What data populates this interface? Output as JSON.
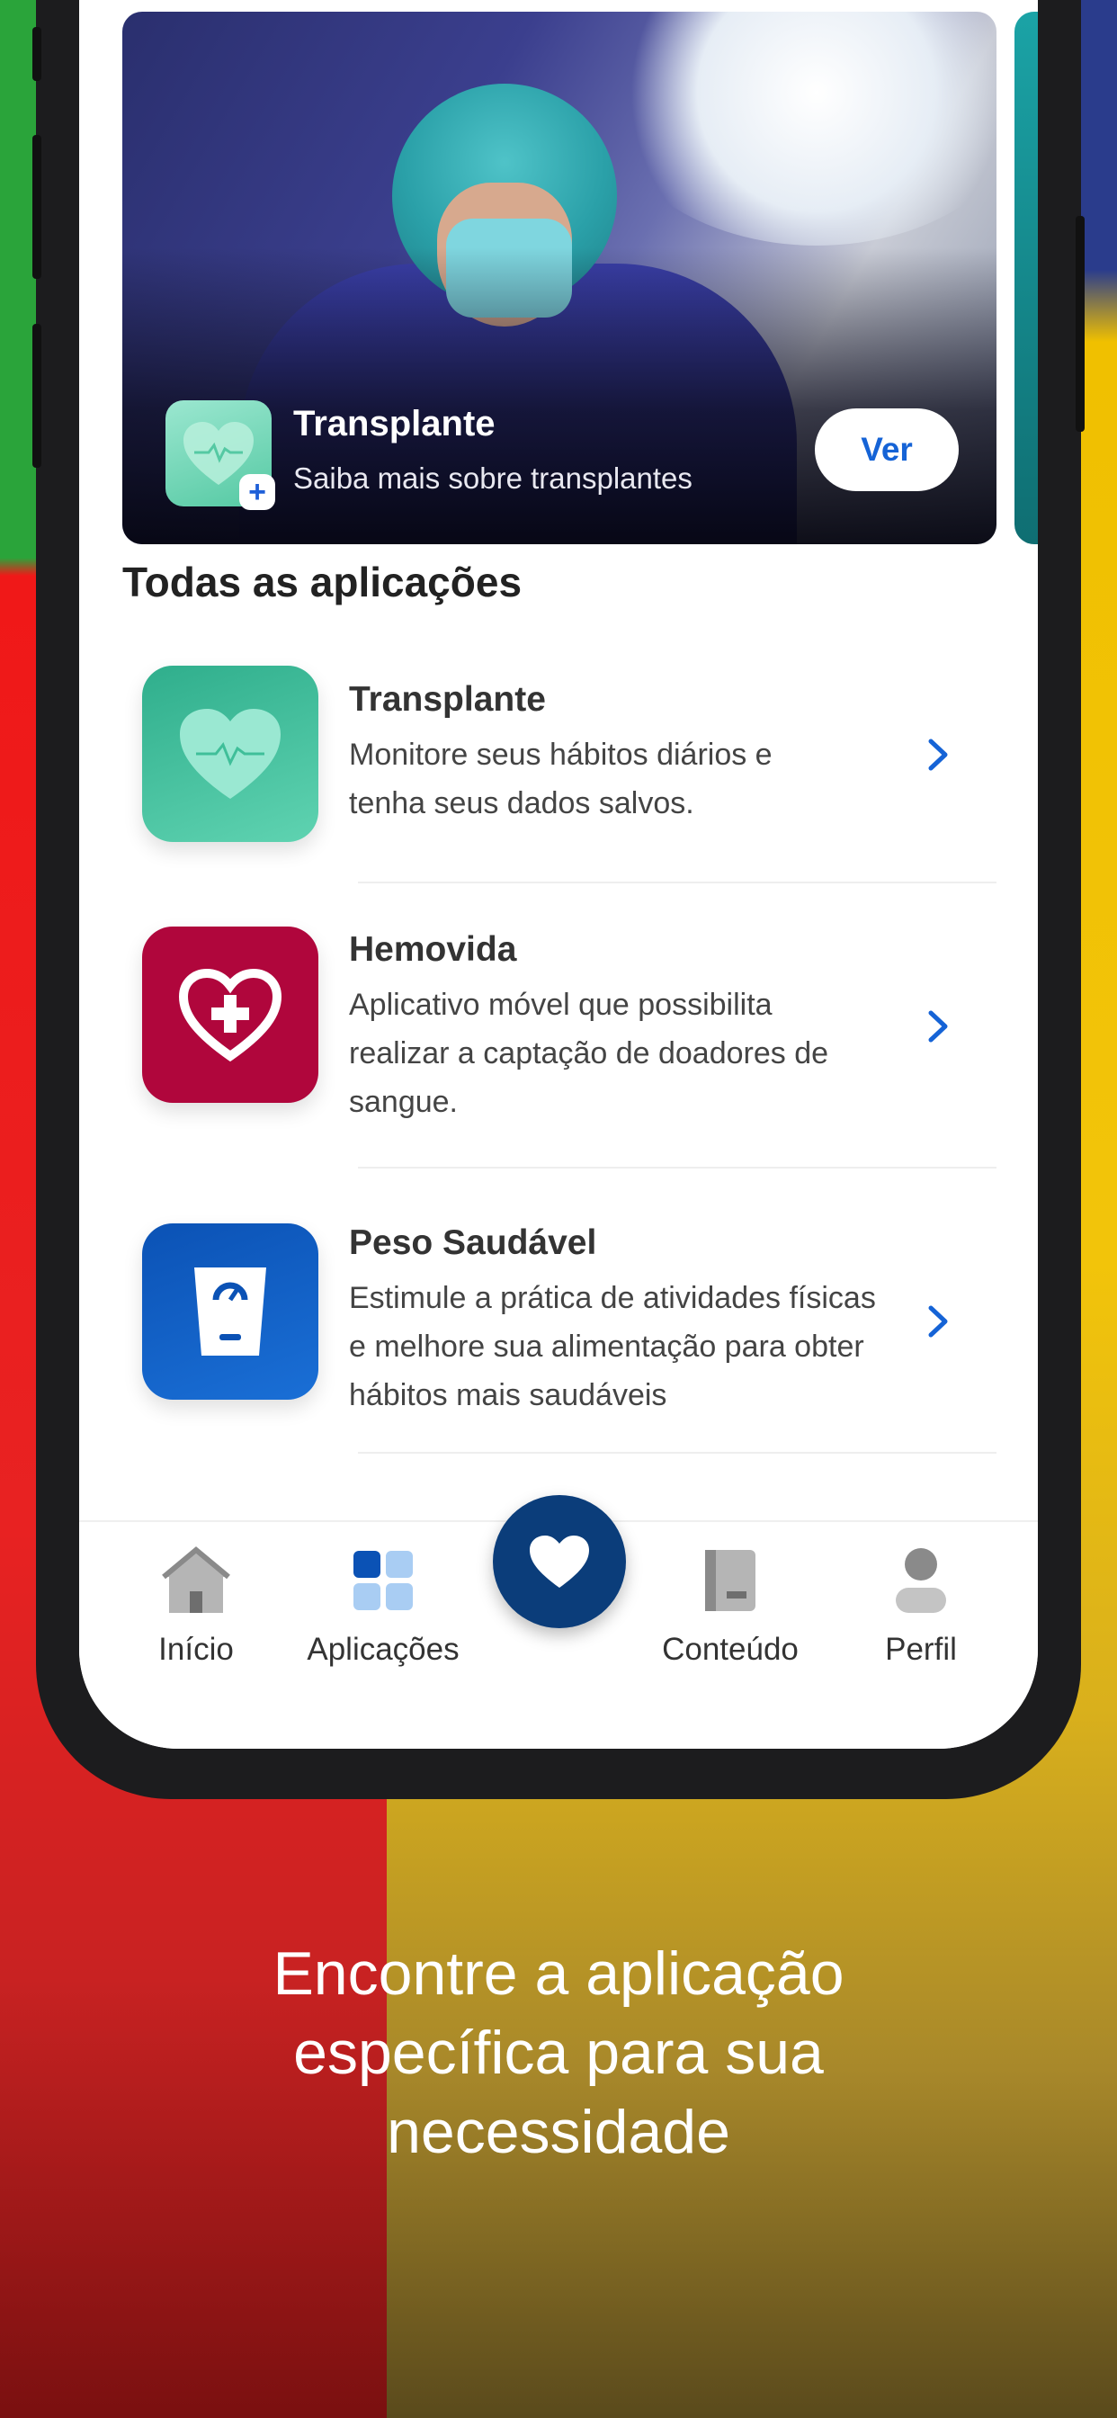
{
  "colors": {
    "accent": "#1563d6",
    "nav_fab": "#0b3d7a",
    "transplante_icon": "#55c9a3",
    "hemovida_icon": "#b0063c",
    "peso_icon": "#0b52b5"
  },
  "banner": {
    "title": "Transplante",
    "subtitle": "Saiba mais sobre transplantes",
    "button_label": "Ver",
    "icon": "heart-plus-icon"
  },
  "section": {
    "title": "Todas as aplicações"
  },
  "apps": [
    {
      "name": "Transplante",
      "description": "Monitore seus hábitos diários e tenha seus dados salvos.",
      "icon": "heart-pulse-icon"
    },
    {
      "name": "Hemovida",
      "description": "Aplicativo móvel que possibilita realizar a captação de doadores de sangue.",
      "icon": "heart-cross-icon"
    },
    {
      "name": "Peso Saudável",
      "description": "Estimule a prática de atividades físicas e melhore sua alimentação para obter hábitos mais saudáveis",
      "icon": "scale-icon"
    }
  ],
  "nav": {
    "items": [
      {
        "label": "Início",
        "icon": "home-icon"
      },
      {
        "label": "Aplicações",
        "icon": "grid-icon",
        "active": true
      },
      {
        "label": "Conteúdo",
        "icon": "book-icon"
      },
      {
        "label": "Perfil",
        "icon": "user-icon"
      }
    ],
    "center_icon": "heart-icon"
  },
  "caption": {
    "line1": "Encontre a aplicação",
    "line2": "específica para sua",
    "line3": "necessidade"
  }
}
